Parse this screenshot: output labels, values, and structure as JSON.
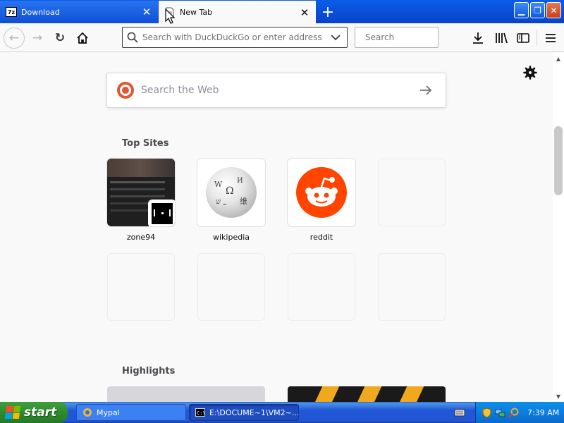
{
  "tabs": [
    {
      "label": "Download",
      "icon": "7z-icon",
      "active": false
    },
    {
      "label": "New Tab",
      "icon": "document-icon",
      "active": true
    }
  ],
  "nav": {
    "url_placeholder": "Search with DuckDuckGo or enter address",
    "search_placeholder": "Search"
  },
  "newtab": {
    "web_search_placeholder": "Search the Web",
    "top_sites_title": "Top Sites",
    "highlights_title": "Highlights",
    "top_sites": [
      {
        "title": "zone94",
        "kind": "screenshot"
      },
      {
        "title": "wikipedia",
        "kind": "icon"
      },
      {
        "title": "reddit",
        "kind": "icon"
      },
      {
        "title": "",
        "kind": "empty"
      },
      {
        "title": "",
        "kind": "empty"
      },
      {
        "title": "",
        "kind": "empty"
      },
      {
        "title": "",
        "kind": "empty"
      },
      {
        "title": "",
        "kind": "empty"
      }
    ]
  },
  "taskbar": {
    "start_label": "start",
    "tasks": [
      {
        "label": "Mypal",
        "icon": "mypal-icon",
        "active": false
      },
      {
        "label": "E:\\DOCUME~1\\VM2~...",
        "icon": "cmd-icon",
        "active": true
      }
    ],
    "clock": "7:39 AM"
  },
  "colors": {
    "tabbar": "#0843c9",
    "accent_reddit": "#ff4500",
    "accent_ddg": "#de5833",
    "start_green": "#2f8a2f",
    "tray_blue": "#0d7ce0"
  }
}
